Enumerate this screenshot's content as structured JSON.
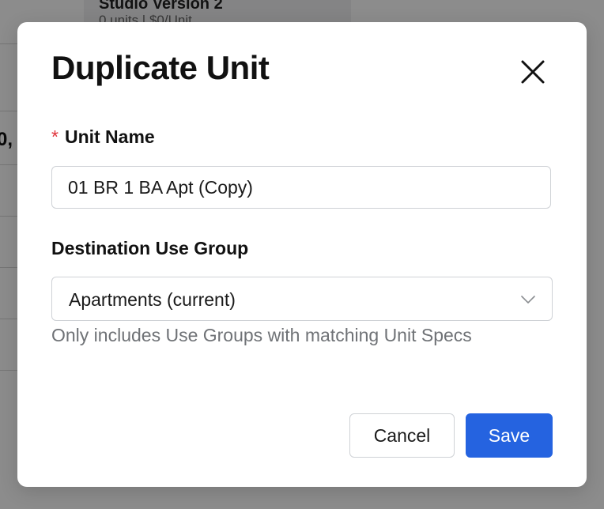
{
  "background": {
    "card_title": "Studio Version 2",
    "card_subtitle": "0 units | $0/Unit",
    "side_value": "0,"
  },
  "modal": {
    "title": "Duplicate Unit",
    "close_icon": "close-icon",
    "unit_name": {
      "required_marker": "*",
      "label": "Unit Name",
      "value": "01 BR 1 BA Apt (Copy)"
    },
    "destination_use_group": {
      "label": "Destination Use Group",
      "selected": "Apartments (current)",
      "chevron_icon": "chevron-down-icon",
      "help_text": "Only includes Use Groups with matching Unit Specs"
    },
    "buttons": {
      "cancel_label": "Cancel",
      "save_label": "Save"
    }
  },
  "colors": {
    "primary": "#2563e0",
    "required": "#e0323a",
    "help_text": "#6f7276"
  }
}
